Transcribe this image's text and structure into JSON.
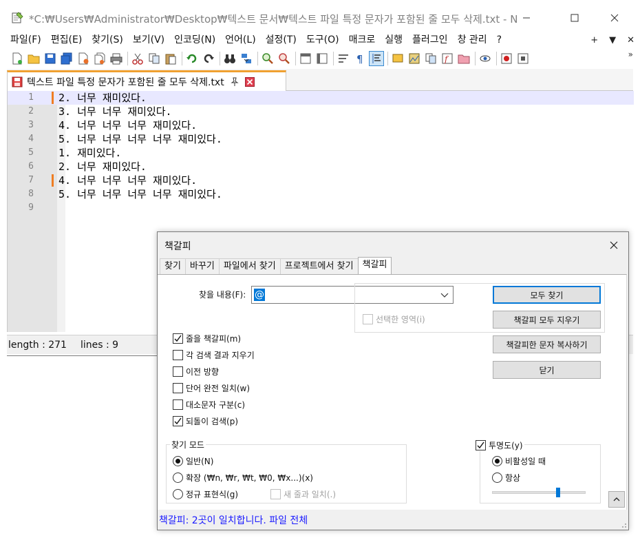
{
  "window": {
    "title": "*C:₩Users₩Administrator₩Desktop₩텍스트 문서₩텍스트 파일 특정 문자가 포함된 줄 모두 삭제.txt - N...",
    "minimize_icon": "minimize-icon",
    "maximize_icon": "maximize-icon",
    "close_icon": "close-icon"
  },
  "menu": {
    "items": [
      "파일(F)",
      "편집(E)",
      "찾기(S)",
      "보기(V)",
      "인코딩(N)",
      "언어(L)",
      "설정(T)",
      "도구(O)",
      "매크로",
      "실행",
      "플러그인",
      "창 관리",
      "?"
    ],
    "right": [
      "+",
      "▼",
      "✕"
    ]
  },
  "toolbar": {
    "overflow": "»"
  },
  "tab": {
    "label": "텍스트 파일 특정 문자가 포함된 줄 모두 삭제.txt"
  },
  "editor": {
    "lines": [
      {
        "num": "1",
        "text": "2. 너무 재미있다.",
        "bookmark": true,
        "current": true
      },
      {
        "num": "2",
        "text": "3. 너무 너무 재미있다.",
        "bookmark": false,
        "current": false
      },
      {
        "num": "3",
        "text": "4. 너무 너무 너무 재미있다.",
        "bookmark": false,
        "current": false
      },
      {
        "num": "4",
        "text": "5. 너무 너무 너무 너무 재미있다.",
        "bookmark": false,
        "current": false
      },
      {
        "num": "5",
        "text": "1. 재미있다.",
        "bookmark": false,
        "current": false
      },
      {
        "num": "6",
        "text": "2. 너무 재미있다.",
        "bookmark": false,
        "current": false
      },
      {
        "num": "7",
        "text": "4. 너무 너무 너무 재미있다.",
        "bookmark": true,
        "current": false
      },
      {
        "num": "8",
        "text": "5. 너무 너무 너무 너무 재미있다.",
        "bookmark": false,
        "current": false
      },
      {
        "num": "9",
        "text": "",
        "bookmark": false,
        "current": false
      }
    ],
    "bookmark_color": "#ef7d22"
  },
  "statusbar": {
    "length": "length : 271",
    "lines": "lines : 9"
  },
  "dialog": {
    "title": "책갈피",
    "tabs": [
      "찾기",
      "바꾸기",
      "파일에서 찾기",
      "프로젝트에서 찾기",
      "책갈피"
    ],
    "active_tab": "책갈피",
    "find_label": "찾을 내용(F):",
    "find_value": "@",
    "in_selection": "선택한 영역(i)",
    "buttons": {
      "find_all": "모두 찾기",
      "clear_bookmarks": "책갈피 모두 지우기",
      "copy_marked": "책갈피한 문자 복사하기",
      "close": "닫기"
    },
    "options": {
      "bookmark_line": "줄을 책갈피(m)",
      "purge": "각 검색 결과 지우기",
      "backward": "이전 방향",
      "whole_word": "단어 완전 일치(w)",
      "match_case": "대소문자 구분(c)",
      "wrap": "되돌이 검색(p)"
    },
    "search_mode": {
      "title": "찾기 모드",
      "normal": "일반(N)",
      "extended": "확장 (₩n, ₩r, ₩t, ₩0, ₩x...)(x)",
      "regex": "정규 표현식(g)",
      "dot_newline": "새 줄과 일치(.)"
    },
    "transparency": {
      "title": "투명도(y)",
      "on_lose_focus": "비활성일 때",
      "always": "항상",
      "level": 0.7
    },
    "collapse": "^",
    "status": "책갈피: 2곳이 일치합니다. 파일 전체",
    "accent": "#0078d7"
  }
}
